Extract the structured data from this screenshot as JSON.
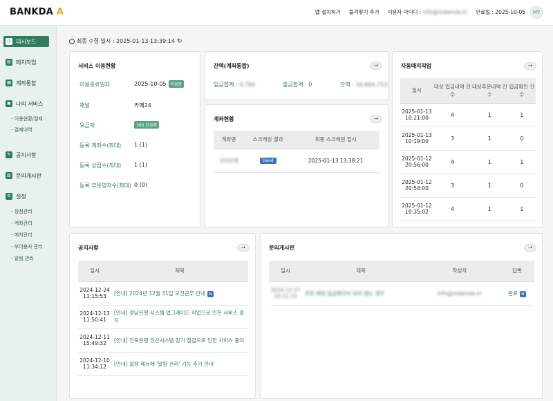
{
  "header": {
    "logo_main": "BANKDA",
    "logo_accent": "A",
    "links": [
      "앱 설치하기",
      "즐겨찾기 추가"
    ],
    "user_label": "이용자 아이디 :",
    "user_id": "info@mdamda.kr",
    "expire_label": "만료일 : 2025-10-05",
    "avatar": "MY"
  },
  "sidebar": {
    "items": [
      {
        "label": "대시보드",
        "icon": "dashboard-icon",
        "glyph": "◷"
      },
      {
        "label": "매치작업",
        "icon": "match-icon",
        "glyph": "▤"
      },
      {
        "label": "계좌통합",
        "icon": "account-icon",
        "glyph": "▦"
      },
      {
        "label": "나의 서비스",
        "icon": "service-icon",
        "glyph": "▣"
      },
      {
        "label": "공지사항",
        "icon": "notice-icon",
        "glyph": "✎"
      },
      {
        "label": "문의게시판",
        "icon": "board-icon",
        "glyph": "▧"
      },
      {
        "label": "설정",
        "icon": "settings-icon",
        "glyph": "⚙"
      }
    ],
    "service_subs": [
      "- 이용현황/결제",
      "- 결제내역"
    ],
    "settings_subs": [
      "- 상점관리",
      "- 계좌관리",
      "- 매치관리",
      "- 부이용자 관리",
      "- 알림 관리"
    ]
  },
  "collect": {
    "text": "최종 수집 일시 : 2025-01-13 13:39:14",
    "refresh": "↻"
  },
  "service": {
    "title": "서비스 이용현황",
    "rows": [
      {
        "label": "이용종료일자",
        "value": "2025-10-05",
        "badge": "이용중"
      },
      {
        "label": "채널",
        "value": "카페24",
        "badge": ""
      },
      {
        "label": "요금제",
        "value": "",
        "badge": "360 요금제"
      },
      {
        "label": "등록 계좌수(최대)",
        "value": "1 (1)",
        "badge": ""
      },
      {
        "label": "등록 상점수(최대)",
        "value": "1 (1)",
        "badge": ""
      },
      {
        "label": "등록 부운영자수(최대)",
        "value": "0 (0)",
        "badge": ""
      }
    ]
  },
  "balance": {
    "title": "잔액(계좌통합)",
    "deposit_label": "입금합계 :",
    "deposit_value": "8,760",
    "withdraw_label": "출금합계 : 0",
    "balance_label": "잔액 :",
    "balance_value": "16,864,753"
  },
  "account": {
    "title": "계좌현황",
    "headers": [
      "계좌명",
      "스크래핑 결과",
      "최종 스크래핑 일시"
    ],
    "rows": [
      {
        "name": "국민은행",
        "status": "Good",
        "time": "2025-01-13 13:38:21"
      }
    ]
  },
  "auto": {
    "title": "자동매치작업",
    "headers": [
      "일시",
      "대상 입금내역 건수",
      "대상주문내역 건수",
      "입금확인 건수"
    ],
    "rows": [
      {
        "date": "2025-01-13",
        "time": "10:21:00",
        "a": "4",
        "b": "1",
        "c": "1"
      },
      {
        "date": "2025-01-13",
        "time": "10:19:00",
        "a": "3",
        "b": "1",
        "c": "0"
      },
      {
        "date": "2025-01-12",
        "time": "20:56:00",
        "a": "4",
        "b": "1",
        "c": "1"
      },
      {
        "date": "2025-01-12",
        "time": "20:54:00",
        "a": "3",
        "b": "1",
        "c": "0"
      },
      {
        "date": "2025-01-12",
        "time": "19:35:02",
        "a": "4",
        "b": "1",
        "c": "1"
      }
    ]
  },
  "notice": {
    "title": "공지사항",
    "headers": [
      "일시",
      "제목"
    ],
    "rows": [
      {
        "date": "2024-12-24",
        "time": "11:15:53",
        "title": "[안내] 2024년 12월 31일 오전근무 안내",
        "new": "N"
      },
      {
        "date": "2024-12-13",
        "time": "11:50:41",
        "title": "[안내] 경남은행 시스템 업그레이드 작업으로 인한 서비스 중지",
        "new": ""
      },
      {
        "date": "2024-12-11",
        "time": "15:49:32",
        "title": "[안내] 전북은행 전산시스템 장기 점검으로 인한 서비스 중지",
        "new": ""
      },
      {
        "date": "2024-12-10",
        "time": "11:34:12",
        "title": "[안내] 설정 메뉴에 '알림 관리' 기능 추가 안내",
        "new": ""
      }
    ]
  },
  "inquiry": {
    "title": "문의게시판",
    "headers": [
      "일시",
      "제목",
      "작성자",
      "답변"
    ],
    "rows": [
      {
        "date": "2024-12-27",
        "time": "10:21:15",
        "title": "주문 매칭 입금확인이 되지 않는 경우",
        "writer": "info@mdamda.kr",
        "answer": "완료",
        "new": "N"
      }
    ]
  }
}
